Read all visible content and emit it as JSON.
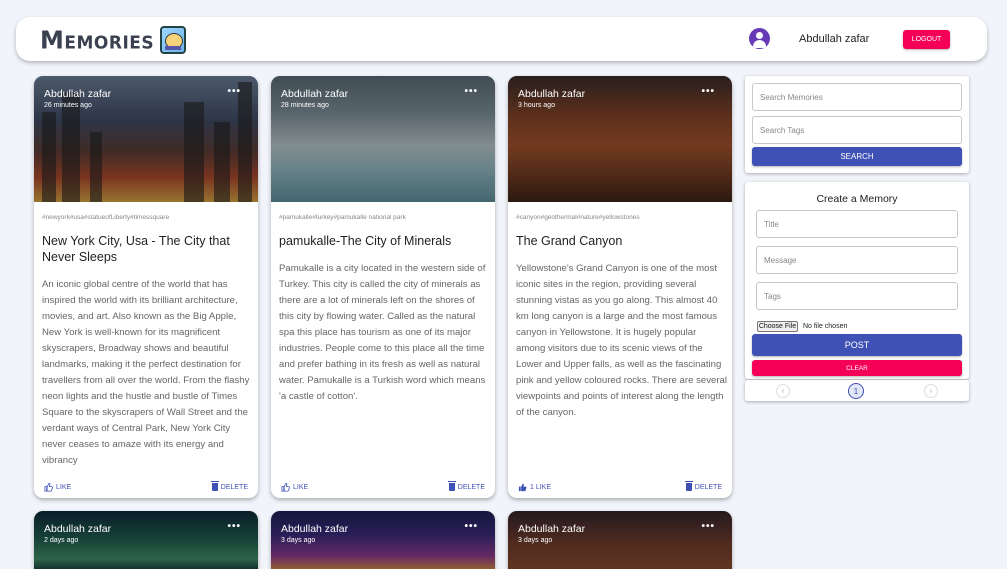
{
  "header": {
    "brand": "Memories",
    "username": "Abdullah zafar",
    "logout_label": "LOGOUT"
  },
  "posts": [
    {
      "author": "Abdullah zafar",
      "time": "26 minutes ago",
      "tags": "#newyork#usa#statueofLiberty#timessquare",
      "title": "New York City, Usa - The City that Never Sleeps",
      "description": "An iconic global centre of the world that has inspired the world with its brilliant architecture, movies, and art. Also known as the Big Apple, New York is well-known for its magnificent skyscrapers, Broadway shows and beautiful landmarks, making it the perfect destination for travellers from all over the world. From the flashy neon lights and the hustle and bustle of Times Square to the skyscrapers of Wall Street and the verdant ways of Central Park, New York City never ceases to amaze with its energy and vibrancy",
      "like_label": "LIKE",
      "delete_label": "DELETE"
    },
    {
      "author": "Abdullah zafar",
      "time": "28 minutes ago",
      "tags": "#pamukalle#turkey#pamukalle national park",
      "title": "pamukalle-The City of Minerals",
      "description": "Pamukalle is a city located in the western side of Turkey. This city is called the city of minerals as there are a lot of minerals left on the shores of this city by flowing water. Called as the natural spa this place has tourism as one of its major industries. People come to this place all the time and prefer bathing in its fresh as well as natural water. Pamukalle is a Turkish word which means 'a castle of cotton'.",
      "like_label": "LIKE",
      "delete_label": "DELETE"
    },
    {
      "author": "Abdullah zafar",
      "time": "3 hours ago",
      "tags": "#canyon#geothermal#nature#yellowstones",
      "title": "The Grand Canyon",
      "description": "Yellowstone's Grand Canyon is one of the most iconic sites in the region, providing several stunning vistas as you go along. This almost 40 km long canyon is a large and the most famous canyon in Yellowstone. It is hugely popular among visitors due to its scenic views of the Lower and Upper falls, as well as the fascinating pink and yellow coloured rocks. There are several viewpoints and points of interest along the length of the canyon.",
      "like_label": "1 LIKE",
      "delete_label": "DELETE"
    },
    {
      "author": "Abdullah zafar",
      "time": "2 days ago"
    },
    {
      "author": "Abdullah zafar",
      "time": "3 days ago"
    },
    {
      "author": "Abdullah zafar",
      "time": "3 days ago"
    }
  ],
  "more_label": "•••",
  "search": {
    "memories_placeholder": "Search Memories",
    "tags_placeholder": "Search Tags",
    "button_label": "SEARCH"
  },
  "form": {
    "title": "Create a Memory",
    "title_placeholder": "Title",
    "message_placeholder": "Message",
    "tags_placeholder": "Tags",
    "file_button": "Choose File",
    "file_status": "No file chosen",
    "post_label": "POST",
    "clear_label": "CLEAR"
  },
  "pagination": {
    "prev": "‹",
    "page": "1",
    "next": "›"
  },
  "colors": {
    "primary": "#3f51b5",
    "secondary": "#f50057",
    "avatar": "#673ab7"
  }
}
